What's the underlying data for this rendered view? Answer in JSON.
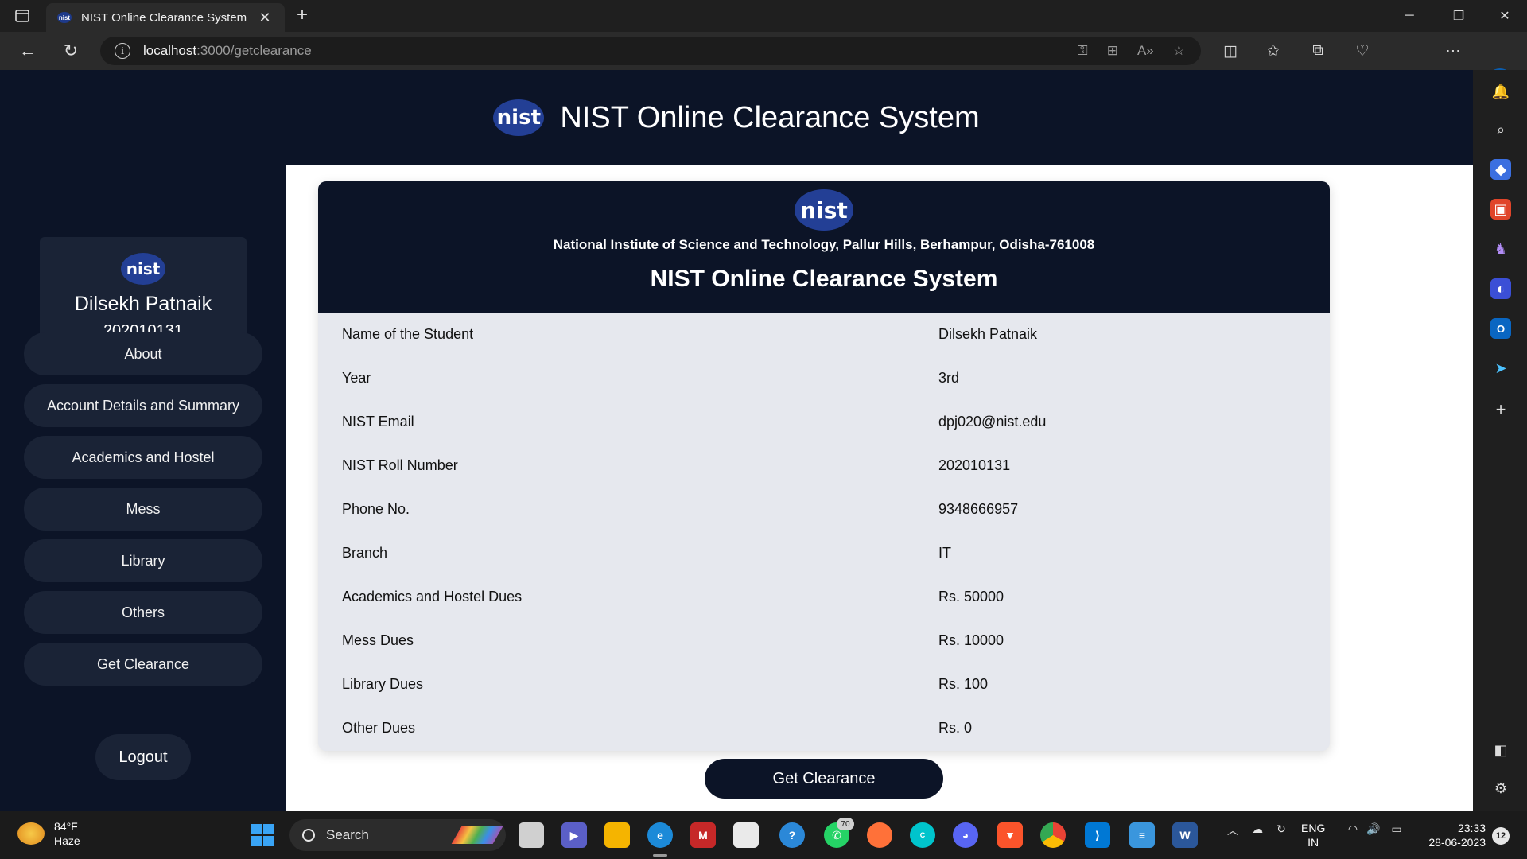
{
  "browser": {
    "tab_title": "NIST Online Clearance System",
    "url_host": "localhost",
    "url_path": ":3000/getclearance",
    "favicon_text": "nist"
  },
  "header": {
    "logo_text": "nist",
    "title": "NIST Online Clearance System"
  },
  "sidebar": {
    "logo_text": "nist",
    "student_name": "Dilsekh Patnaik",
    "student_roll": "202010131",
    "menu": [
      {
        "label": "About"
      },
      {
        "label": "Account Details and Summary"
      },
      {
        "label": "Academics and Hostel"
      },
      {
        "label": "Mess"
      },
      {
        "label": "Library"
      },
      {
        "label": "Others"
      },
      {
        "label": "Get Clearance"
      }
    ],
    "logout_label": "Logout"
  },
  "card": {
    "logo_text": "nist",
    "institute": "National Instiute of Science and Technology, Pallur Hills, Berhampur, Odisha-761008",
    "title": "NIST Online Clearance System",
    "rows": [
      {
        "label": "Name of the Student",
        "value": "Dilsekh Patnaik"
      },
      {
        "label": "Year",
        "value": "3rd"
      },
      {
        "label": "NIST Email",
        "value": "dpj020@nist.edu"
      },
      {
        "label": "NIST Roll Number",
        "value": "202010131"
      },
      {
        "label": "Phone No.",
        "value": "9348666957"
      },
      {
        "label": "Branch",
        "value": "IT"
      },
      {
        "label": "Academics and Hostel Dues",
        "value": "Rs. 50000"
      },
      {
        "label": "Mess Dues",
        "value": "Rs. 10000"
      },
      {
        "label": "Library Dues",
        "value": "Rs. 100"
      },
      {
        "label": "Other Dues",
        "value": "Rs. 0"
      }
    ]
  },
  "clearance_button": "Get Clearance",
  "taskbar": {
    "weather_temp": "84°F",
    "weather_desc": "Haze",
    "search_label": "Search",
    "whatsapp_badge": "70",
    "lang_top": "ENG",
    "lang_bottom": "IN",
    "time": "23:33",
    "date": "28-06-2023",
    "notifications": "12"
  },
  "colors": {
    "page_bg": "#0c1427",
    "panel_bg": "#1a2336",
    "card_bg": "#e6e8ee",
    "logo_blue": "#233f95"
  }
}
